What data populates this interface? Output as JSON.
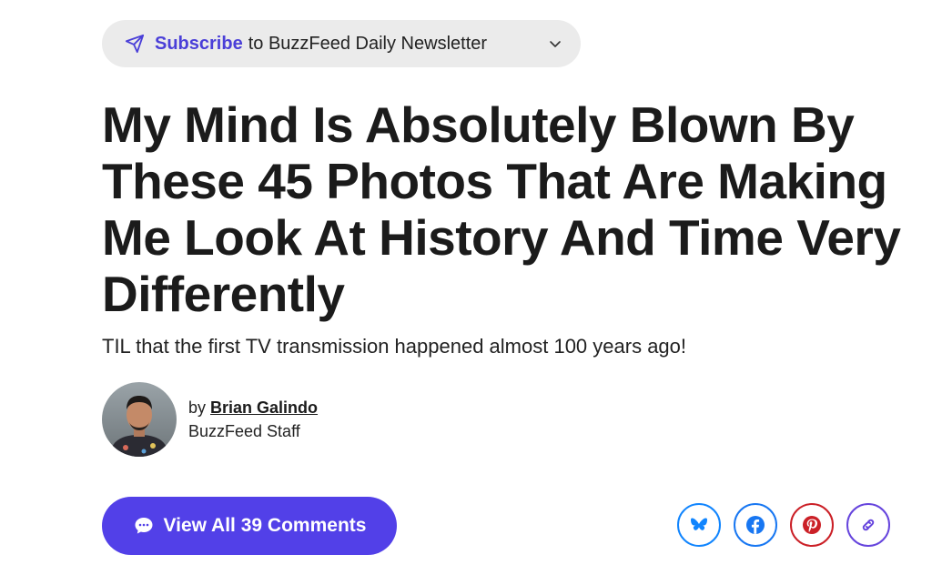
{
  "subscribe": {
    "strong": "Subscribe",
    "rest": "to BuzzFeed Daily Newsletter",
    "icon": "paper-plane-icon",
    "chevron_icon": "chevron-down-icon",
    "accent_color": "#4a3fd8"
  },
  "article": {
    "headline": "My Mind Is Absolutely Blown By These 45 Photos That Are Making Me Look At History And Time Very Differently",
    "dek": "TIL that the first TV transmission happened almost 100 years ago!"
  },
  "author": {
    "by_prefix": "by",
    "name": "Brian Galindo",
    "role": "BuzzFeed Staff"
  },
  "comments": {
    "label": "View All 39 Comments",
    "icon": "comment-bubble-icon",
    "color": "#5240e8"
  },
  "share": {
    "buttons": [
      {
        "name": "bluesky",
        "icon": "butterfly-icon",
        "color": "#1185fe"
      },
      {
        "name": "facebook",
        "icon": "facebook-icon",
        "color": "#1877f2"
      },
      {
        "name": "pinterest",
        "icon": "pinterest-icon",
        "color": "#cb2027"
      },
      {
        "name": "copy-link",
        "icon": "link-icon",
        "color": "#6645dd"
      }
    ]
  }
}
